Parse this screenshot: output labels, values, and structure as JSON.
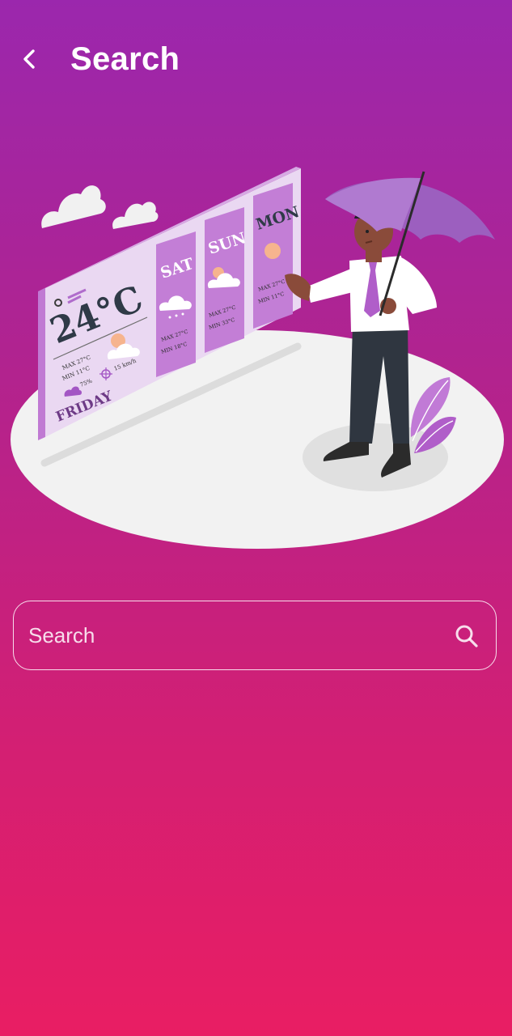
{
  "header": {
    "title": "Search",
    "back_icon": "chevron-left-icon"
  },
  "illustration": {
    "today_temp": "24°C",
    "today_max": "MAX 27°C",
    "today_min": "MIN 11°C",
    "today_humidity": "75%",
    "today_wind": "15 km/h",
    "today_day": "FRIDAY",
    "forecast": [
      {
        "day": "SAT",
        "max": "MAX 27°C",
        "min": "MIN 18°C"
      },
      {
        "day": "SUN",
        "max": "MAX 27°C",
        "min": "MIN 33°C"
      },
      {
        "day": "MON",
        "max": "MAX 27°C",
        "min": "MIN 11°C"
      }
    ]
  },
  "search": {
    "placeholder": "Search",
    "value": "",
    "icon": "search-icon"
  },
  "colors": {
    "gradient_top": "#9b27ad",
    "gradient_bottom": "#e91e63",
    "accent_purple": "#b34fd1",
    "text": "#ffffff"
  }
}
